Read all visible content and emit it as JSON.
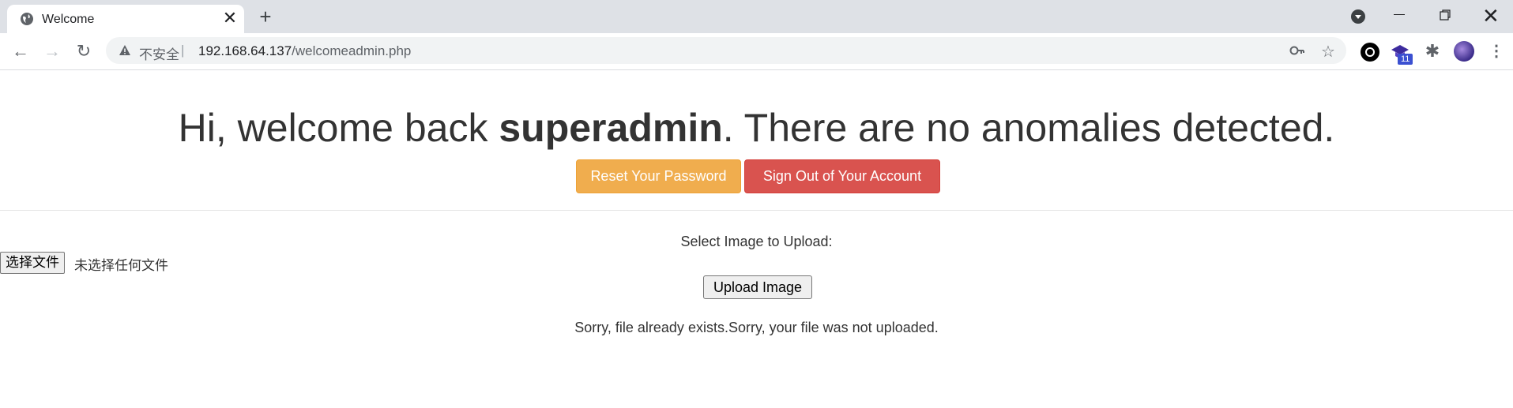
{
  "browser": {
    "tab": {
      "title": "Welcome",
      "close": "✕"
    },
    "new_tab": "+",
    "window": {
      "close": "✕"
    },
    "toolbar": {
      "back": "←",
      "forward": "→",
      "reload": "↻",
      "security_label": "不安全",
      "separator": "|",
      "url_host": "192.168.64.137",
      "url_path": "/welcomeadmin.php",
      "bookmark_star": "☆",
      "extensions_badge": "11",
      "menu": "⋮",
      "puzzle": "✱"
    },
    "colors": {
      "tabstrip": "#dee1e6",
      "omnibox": "#f1f3f4"
    }
  },
  "page": {
    "heading": {
      "prefix": "Hi, welcome back ",
      "username": "superadmin",
      "suffix": ". There are no anomalies detected."
    },
    "buttons": {
      "reset_password": "Reset Your Password",
      "sign_out": "Sign Out of Your Account"
    },
    "upload": {
      "label": "Select Image to Upload:",
      "choose_file": "选择文件",
      "no_file": "未选择任何文件",
      "submit": "Upload Image"
    },
    "message": "Sorry, file already exists.Sorry, your file was not uploaded.",
    "colors": {
      "warning": "#f0ad4e",
      "danger": "#d9534f",
      "text": "#333333"
    }
  }
}
